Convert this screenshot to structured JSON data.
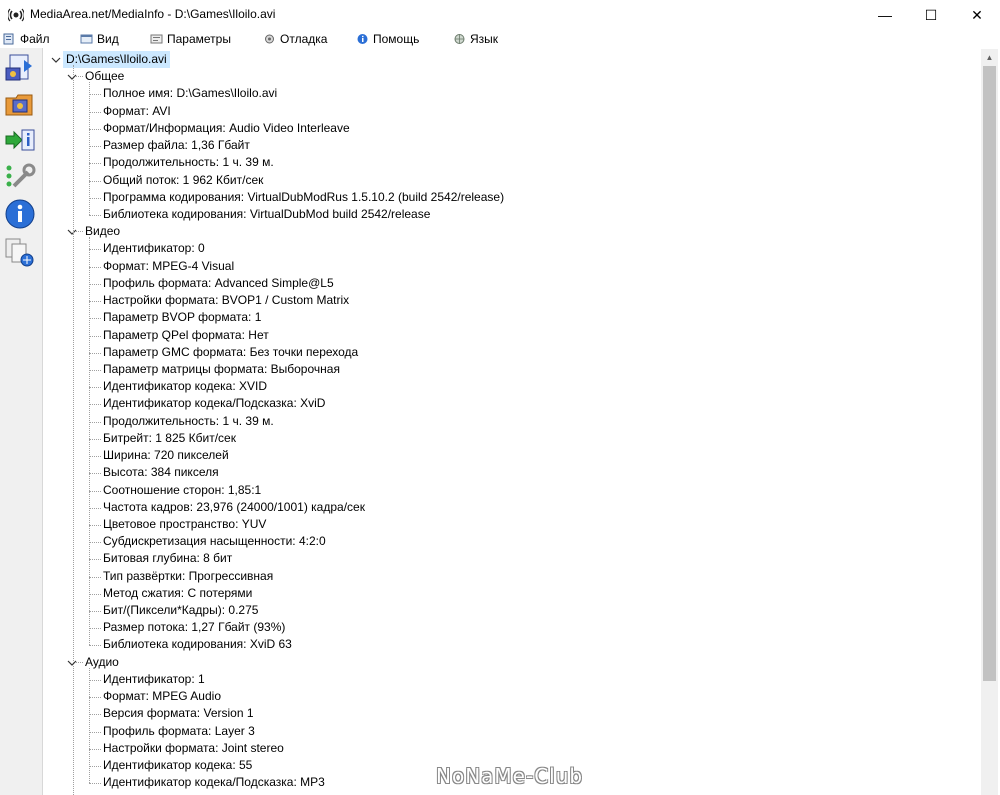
{
  "window": {
    "title": "MediaArea.net/MediaInfo - D:\\Games\\Iloilo.avi",
    "minimize": "—",
    "maximize": "☐",
    "close": "✕"
  },
  "menu": [
    {
      "label": "Файл",
      "icon": "file-icon"
    },
    {
      "label": "Вид",
      "icon": "view-icon"
    },
    {
      "label": "Параметры",
      "icon": "options-icon"
    },
    {
      "label": "Отладка",
      "icon": "debug-icon"
    },
    {
      "label": "Помощь",
      "icon": "help-icon"
    },
    {
      "label": "Язык",
      "icon": "language-icon"
    }
  ],
  "toolbar": [
    {
      "icon": "open-file-icon"
    },
    {
      "icon": "open-folder-icon"
    },
    {
      "icon": "export-info-icon"
    },
    {
      "icon": "preferences-tools-icon"
    },
    {
      "icon": "about-info-icon"
    },
    {
      "icon": "knowledge-base-icon"
    }
  ],
  "tree": {
    "root": "D:\\Games\\Iloilo.avi",
    "sections": [
      {
        "name": "Общее",
        "items": [
          "Полное имя: D:\\Games\\Iloilo.avi",
          "Формат: AVI",
          "Формат/Информация: Audio Video Interleave",
          "Размер файла: 1,36 Гбайт",
          "Продолжительность: 1 ч. 39 м.",
          "Общий поток: 1 962 Кбит/сек",
          "Программа кодирования: VirtualDubModRus 1.5.10.2 (build 2542/release)",
          "Библиотека кодирования: VirtualDubMod build 2542/release"
        ]
      },
      {
        "name": "Видео",
        "items": [
          "Идентификатор: 0",
          "Формат: MPEG-4 Visual",
          "Профиль формата: Advanced Simple@L5",
          "Настройки формата: BVOP1 / Custom Matrix",
          "Параметр BVOP формата: 1",
          "Параметр QPel формата: Нет",
          "Параметр GMC формата: Без точки перехода",
          "Параметр матрицы формата: Выборочная",
          "Идентификатор кодека: XVID",
          "Идентификатор кодека/Подсказка: XviD",
          "Продолжительность: 1 ч. 39 м.",
          "Битрейт: 1 825 Кбит/сек",
          "Ширина: 720 пикселей",
          "Высота: 384 пикселя",
          "Соотношение сторон: 1,85:1",
          "Частота кадров: 23,976 (24000/1001) кадра/сек",
          "Цветовое пространство: YUV",
          "Субдискретизация насыщенности: 4:2:0",
          "Битовая глубина: 8 бит",
          "Тип развёртки: Прогрессивная",
          "Метод сжатия: С потерями",
          "Бит/(Пиксели*Кадры): 0.275",
          "Размер потока: 1,27 Гбайт (93%)",
          "Библиотека кодирования: XviD 63"
        ]
      },
      {
        "name": "Аудио",
        "items": [
          "Идентификатор: 1",
          "Формат: MPEG Audio",
          "Версия формата: Version 1",
          "Профиль формата: Layer 3",
          "Настройки формата: Joint stereo",
          "Идентификатор кодека: 55",
          "Идентификатор кодека/Подсказка: MP3"
        ]
      }
    ]
  },
  "watermark": "NoNaMe-Club"
}
